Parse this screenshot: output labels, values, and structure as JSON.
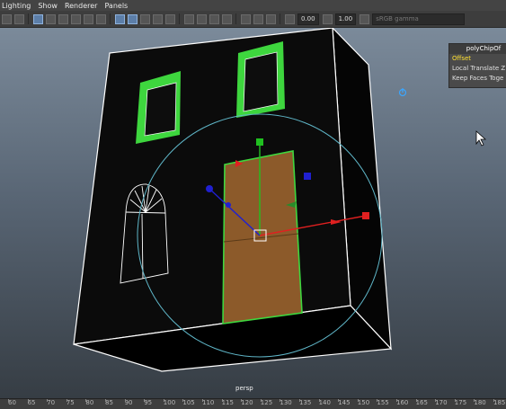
{
  "menubar": {
    "items": [
      {
        "label": "Lighting"
      },
      {
        "label": "Show"
      },
      {
        "label": "Renderer"
      },
      {
        "label": "Panels"
      }
    ]
  },
  "toolbar": {
    "exposure_value": "0.00",
    "gamma_value": "1.00",
    "colorspace_label": "sRGB gamma"
  },
  "popup": {
    "title": "polyChipOf",
    "rows": [
      {
        "label": "Offset"
      },
      {
        "label": "Local Translate Z"
      },
      {
        "label": "Keep Faces Toge"
      }
    ]
  },
  "viewport": {
    "camera_label": "persp"
  },
  "timeline": {
    "ticks": [
      "60",
      "65",
      "70",
      "75",
      "80",
      "85",
      "90",
      "95",
      "100",
      "105",
      "110",
      "115",
      "120",
      "125",
      "130",
      "135",
      "140",
      "145",
      "150",
      "155",
      "160",
      "165",
      "170",
      "175",
      "180",
      "185"
    ]
  },
  "colors": {
    "selection_green": "#3ed63e",
    "door_face": "#8c5a2a",
    "manipulator_red": "#e02020",
    "manipulator_blue": "#2020d0",
    "manipulator_green": "#20c020"
  }
}
